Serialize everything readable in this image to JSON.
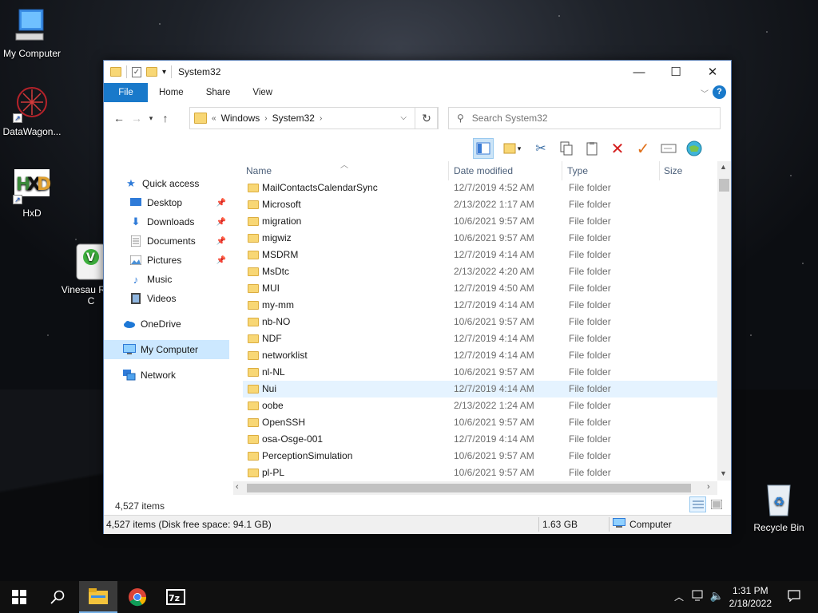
{
  "desktop": {
    "icons": [
      {
        "label": "My Computer"
      },
      {
        "label": "DataWagon..."
      },
      {
        "label": "HxD"
      },
      {
        "label": "Vinesau ROM C"
      },
      {
        "label": "Recycle Bin"
      }
    ]
  },
  "window": {
    "title": "System32",
    "ribbon_tabs": [
      "File",
      "Home",
      "Share",
      "View"
    ],
    "help_label": "?",
    "address": {
      "prefix": "«",
      "crumbs": [
        "Windows",
        "System32"
      ]
    },
    "search": {
      "placeholder": "Search System32"
    }
  },
  "nav": {
    "items": [
      {
        "label": "Quick access",
        "icon": "star-icon"
      },
      {
        "label": "Desktop",
        "icon": "desktop-icon",
        "pinned": true
      },
      {
        "label": "Downloads",
        "icon": "download-icon",
        "pinned": true
      },
      {
        "label": "Documents",
        "icon": "documents-icon",
        "pinned": true
      },
      {
        "label": "Pictures",
        "icon": "pictures-icon",
        "pinned": true
      },
      {
        "label": "Music",
        "icon": "music-icon"
      },
      {
        "label": "Videos",
        "icon": "videos-icon"
      },
      {
        "label": "OneDrive",
        "icon": "cloud-icon"
      },
      {
        "label": "My Computer",
        "icon": "computer-icon",
        "selected": true
      },
      {
        "label": "Network",
        "icon": "network-icon"
      }
    ]
  },
  "columns": {
    "name": "Name",
    "date": "Date modified",
    "type": "Type",
    "size": "Size"
  },
  "files": [
    {
      "name": "MailContactsCalendarSync",
      "date": "12/7/2019 4:52 AM",
      "type": "File folder"
    },
    {
      "name": "Microsoft",
      "date": "2/13/2022 1:17 AM",
      "type": "File folder"
    },
    {
      "name": "migration",
      "date": "10/6/2021 9:57 AM",
      "type": "File folder"
    },
    {
      "name": "migwiz",
      "date": "10/6/2021 9:57 AM",
      "type": "File folder"
    },
    {
      "name": "MSDRM",
      "date": "12/7/2019 4:14 AM",
      "type": "File folder"
    },
    {
      "name": "MsDtc",
      "date": "2/13/2022 4:20 AM",
      "type": "File folder"
    },
    {
      "name": "MUI",
      "date": "12/7/2019 4:50 AM",
      "type": "File folder"
    },
    {
      "name": "my-mm",
      "date": "12/7/2019 4:14 AM",
      "type": "File folder"
    },
    {
      "name": "nb-NO",
      "date": "10/6/2021 9:57 AM",
      "type": "File folder"
    },
    {
      "name": "NDF",
      "date": "12/7/2019 4:14 AM",
      "type": "File folder"
    },
    {
      "name": "networklist",
      "date": "12/7/2019 4:14 AM",
      "type": "File folder"
    },
    {
      "name": "nl-NL",
      "date": "10/6/2021 9:57 AM",
      "type": "File folder"
    },
    {
      "name": "Nui",
      "date": "12/7/2019 4:14 AM",
      "type": "File folder",
      "hover": true
    },
    {
      "name": "oobe",
      "date": "2/13/2022 1:24 AM",
      "type": "File folder"
    },
    {
      "name": "OpenSSH",
      "date": "10/6/2021 9:57 AM",
      "type": "File folder"
    },
    {
      "name": "osa-Osge-001",
      "date": "12/7/2019 4:14 AM",
      "type": "File folder"
    },
    {
      "name": "PerceptionSimulation",
      "date": "10/6/2021 9:57 AM",
      "type": "File folder"
    },
    {
      "name": "pl-PL",
      "date": "10/6/2021 9:57 AM",
      "type": "File folder"
    }
  ],
  "status": {
    "item_count": "4,527 items",
    "details": "4,527 items (Disk free space: 94.1 GB)",
    "size": "1.63 GB",
    "location": "Computer"
  },
  "taskbar": {
    "time": "1:31 PM",
    "date": "2/18/2022"
  }
}
